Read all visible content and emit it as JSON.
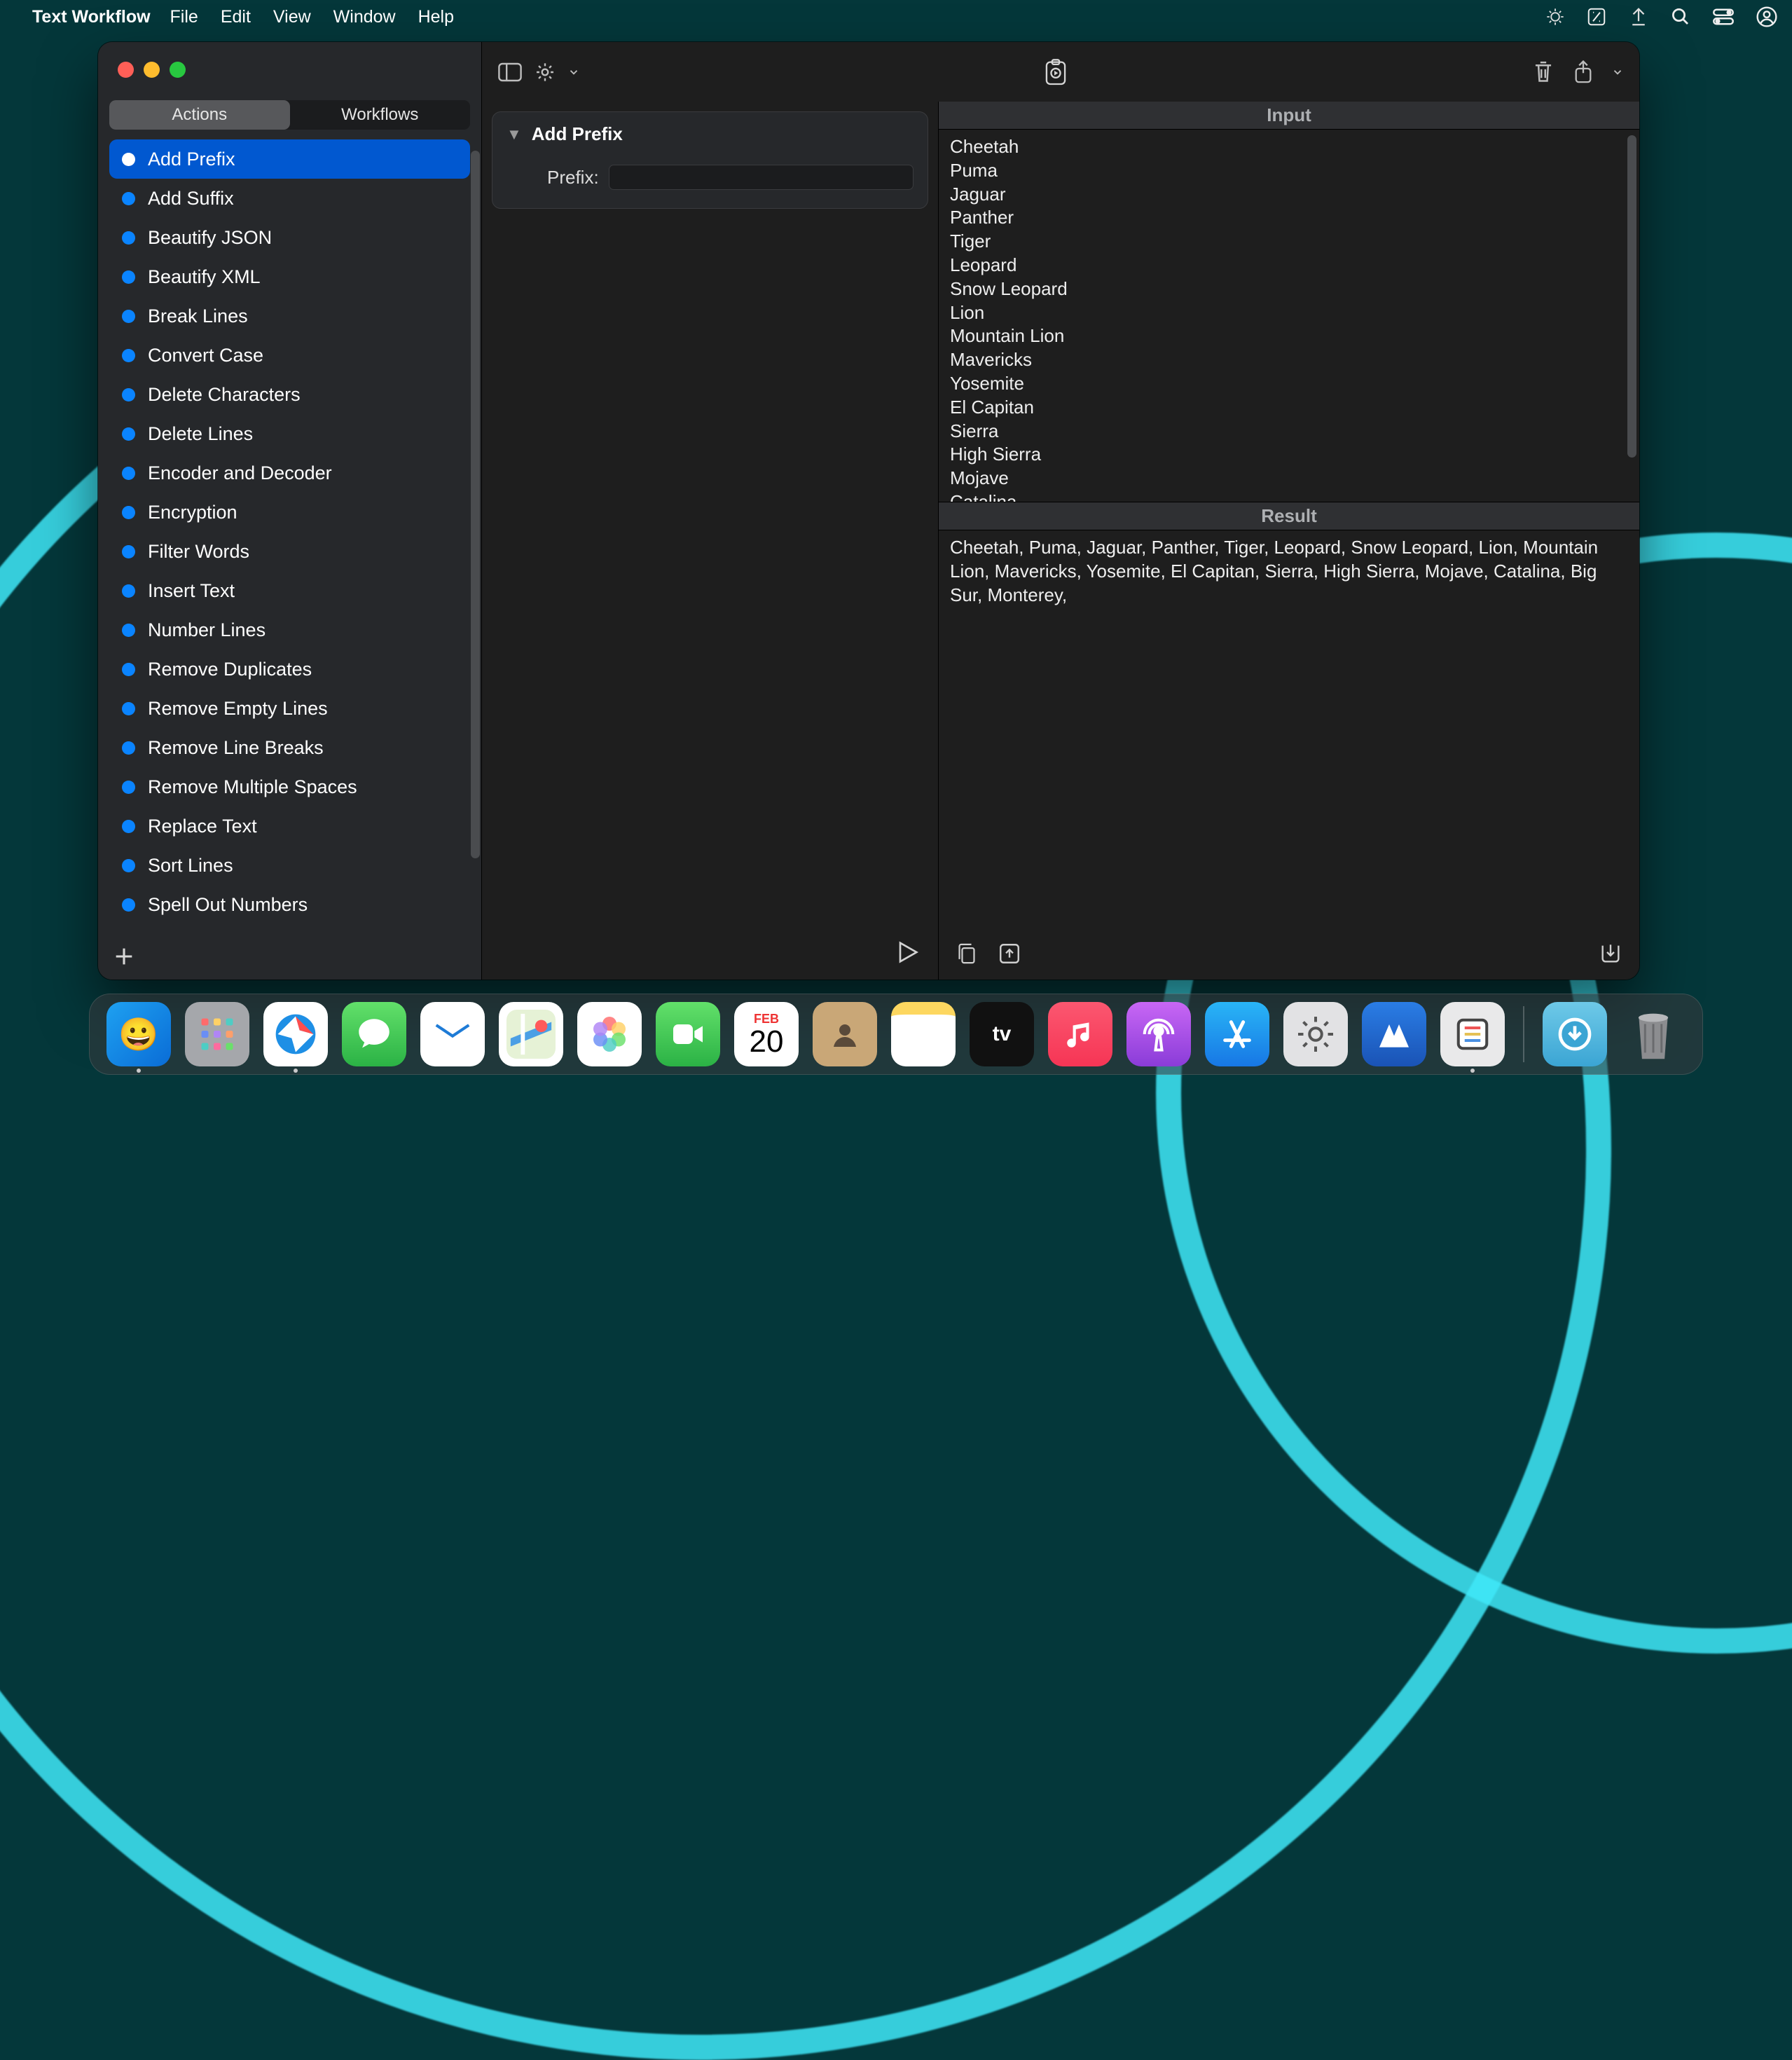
{
  "menubar": {
    "app_name": "Text Workflow",
    "items": [
      "File",
      "Edit",
      "View",
      "Window",
      "Help"
    ]
  },
  "window": {
    "tabs": {
      "actions": "Actions",
      "workflows": "Workflows"
    },
    "actions_list": [
      "Add Prefix",
      "Add Suffix",
      "Beautify JSON",
      "Beautify XML",
      "Break Lines",
      "Convert Case",
      "Delete Characters",
      "Delete Lines",
      "Encoder and Decoder",
      "Encryption",
      "Filter Words",
      "Insert Text",
      "Number Lines",
      "Remove Duplicates",
      "Remove Empty Lines",
      "Remove Line Breaks",
      "Remove Multiple Spaces",
      "Replace Text",
      "Sort Lines",
      "Spell Out Numbers"
    ],
    "selected_action_index": 0,
    "action_card": {
      "title": "Add Prefix",
      "prefix_label": "Prefix:",
      "prefix_value": ""
    },
    "io": {
      "input_header": "Input",
      "result_header": "Result",
      "input_text": "Cheetah\nPuma\nJaguar\nPanther\nTiger\nLeopard\nSnow Leopard\nLion\nMountain Lion\nMavericks\nYosemite\nEl Capitan\nSierra\nHigh Sierra\nMojave\nCatalina",
      "result_text": "Cheetah, Puma, Jaguar, Panther, Tiger, Leopard, Snow Leopard, Lion, Mountain Lion, Mavericks, Yosemite, El Capitan, Sierra, High Sierra, Mojave, Catalina, Big Sur, Monterey,"
    }
  },
  "dock": {
    "calendar": {
      "month": "FEB",
      "day": "20"
    }
  }
}
